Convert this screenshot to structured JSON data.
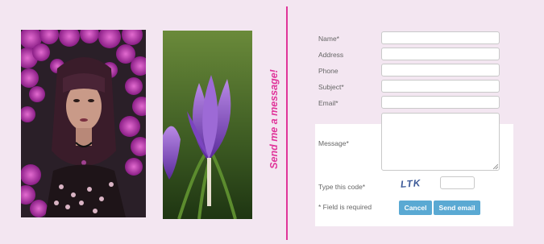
{
  "heading": "Send me a message!",
  "form": {
    "fields": [
      {
        "label": "Name*"
      },
      {
        "label": "Address"
      },
      {
        "label": "Phone"
      },
      {
        "label": "Subject*"
      },
      {
        "label": "Email*"
      }
    ],
    "message_label": "Message*",
    "code_label": "Type this code*",
    "captcha_text": "LTK",
    "required_note": "* Field is required",
    "cancel_label": "Cancel",
    "send_label": "Send email"
  },
  "colors": {
    "accent": "#e0359a",
    "button": "#5aa9d3",
    "background": "#f3e6f1"
  }
}
